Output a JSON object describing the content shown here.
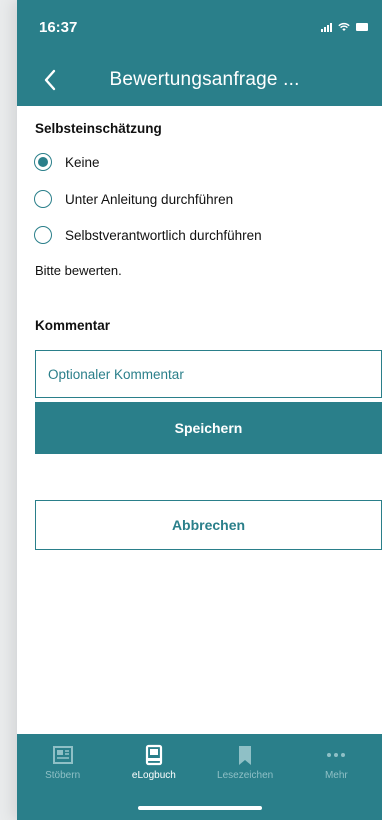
{
  "status_bar": {
    "time": "16:37"
  },
  "nav": {
    "title": "Bewertungsanfrage ..."
  },
  "self_assessment": {
    "heading": "Selbsteinschätzung",
    "options": [
      {
        "label": "Keine",
        "selected": true
      },
      {
        "label": "Unter Anleitung durchführen",
        "selected": false
      },
      {
        "label": "Selbstverantwortlich durchführen",
        "selected": false
      }
    ],
    "hint": "Bitte bewerten."
  },
  "comment": {
    "heading": "Kommentar",
    "placeholder": "Optionaler Kommentar",
    "value": ""
  },
  "actions": {
    "save_label": "Speichern",
    "cancel_label": "Abbrechen"
  },
  "tab_bar": {
    "items": [
      {
        "label": "Stöbern",
        "icon": "newspaper-icon",
        "active": false
      },
      {
        "label": "eLogbuch",
        "icon": "book-icon",
        "active": true
      },
      {
        "label": "Lesezeichen",
        "icon": "bookmark-icon",
        "active": false
      },
      {
        "label": "Mehr",
        "icon": "more-dots-icon",
        "active": false
      }
    ]
  },
  "colors": {
    "brand": "#2a7f8a",
    "tab_inactive": "#8fc0c6"
  }
}
